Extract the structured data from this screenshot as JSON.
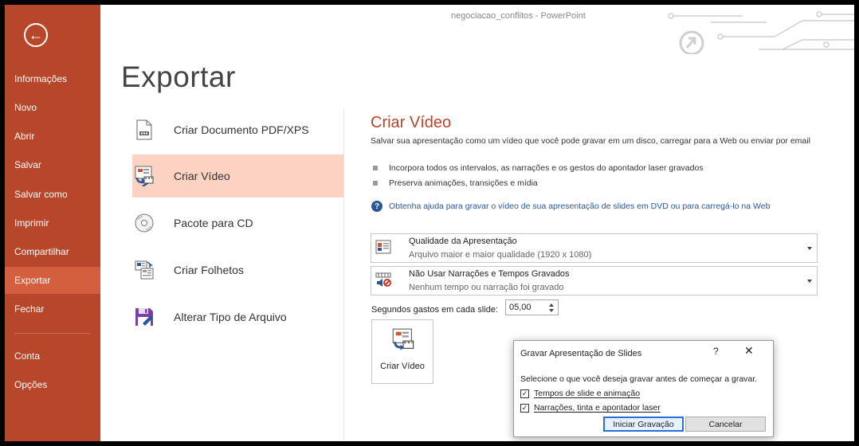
{
  "window": {
    "title": "negociacao_conflitos - PowerPoint"
  },
  "sidebar": {
    "back_icon": "arrow-left-circle-icon",
    "items": [
      {
        "label": "Informações"
      },
      {
        "label": "Novo"
      },
      {
        "label": "Abrir"
      },
      {
        "label": "Salvar"
      },
      {
        "label": "Salvar como"
      },
      {
        "label": "Imprimir"
      },
      {
        "label": "Compartilhar"
      },
      {
        "label": "Exportar",
        "active": true
      },
      {
        "label": "Fechar"
      },
      {
        "label": "Conta"
      },
      {
        "label": "Opções"
      }
    ],
    "color": "#b7472a",
    "active_color": "#d35f3f"
  },
  "main": {
    "title": "Exportar",
    "options": [
      {
        "label": "Criar Documento PDF/XPS",
        "icon": "pdf-document-icon"
      },
      {
        "label": "Criar Vídeo",
        "icon": "video-icon",
        "active": true
      },
      {
        "label": "Pacote para CD",
        "icon": "cd-icon"
      },
      {
        "label": "Criar Folhetos",
        "icon": "handouts-icon"
      },
      {
        "label": "Alterar Tipo de Arquivo",
        "icon": "save-as-icon"
      }
    ]
  },
  "detail": {
    "title": "Criar Vídeo",
    "description": "Salvar sua apresentação como um vídeo que você pode gravar em um disco, carregar para a Web ou enviar por email",
    "bullets": [
      "Incorpora todos os intervalos, as narrações e os gestos do apontador laser gravados",
      "Preserva animações, transições e mídia"
    ],
    "help_link": "Obtenha ajuda para gravar o vídeo de sua apresentação de slides em DVD ou para carregá-lo na Web",
    "quality": {
      "title": "Qualidade da Apresentação",
      "subtitle": "Arquivo maior e maior qualidade (1920 x 1080)"
    },
    "narration": {
      "title": "Não Usar Narrações e Tempos Gravados",
      "subtitle": "Nenhum tempo ou narração foi gravado"
    },
    "seconds_label": "Segundos gastos em cada slide:",
    "seconds_value": "05,00",
    "create_button": "Criar Vídeo"
  },
  "dialog": {
    "title": "Gravar Apresentação de Slides",
    "help": "?",
    "close": "✕",
    "message": "Selecione o que você deseja gravar antes de começar a gravar.",
    "options": [
      {
        "label": "Tempos de slide e animação",
        "checked": true
      },
      {
        "label": "Narrações, tinta e apontador laser",
        "checked": true
      }
    ],
    "start_button": "Iniciar Gravação",
    "cancel_button": "Cancelar"
  }
}
